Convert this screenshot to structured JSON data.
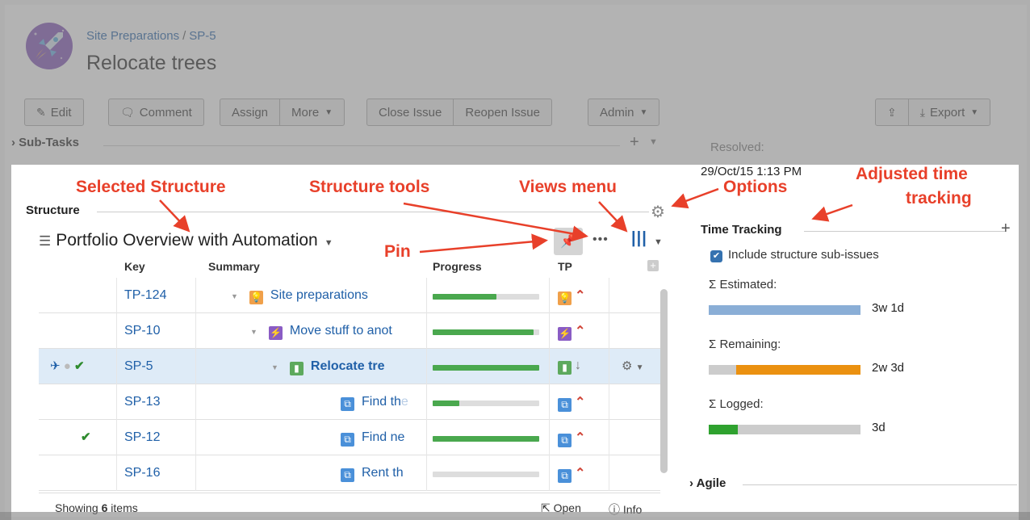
{
  "header": {
    "project": "Site Preparations",
    "separator": "/",
    "issue_key": "SP-5",
    "title": "Relocate trees"
  },
  "toolbar": {
    "edit": "Edit",
    "comment": "Comment",
    "assign": "Assign",
    "more": "More",
    "close_issue": "Close Issue",
    "reopen_issue": "Reopen Issue",
    "admin": "Admin",
    "export": "Export"
  },
  "subtasks": {
    "label": "Sub-Tasks"
  },
  "structure": {
    "label": "Structure",
    "name": "Portfolio Overview with Automation",
    "columns": {
      "key": "Key",
      "summary": "Summary",
      "progress": "Progress",
      "tp": "TP"
    },
    "rows": [
      {
        "key": "TP-124",
        "summary": "Site preparations",
        "summary_fade": "",
        "type": "bulb",
        "type_color": "#f0a04a",
        "progress": 0.6,
        "priority": "highest",
        "marks": ""
      },
      {
        "key": "SP-10",
        "summary": "Move stuff to anot",
        "summary_fade": "",
        "type": "bolt",
        "type_color": "#8a5cc4",
        "progress": 0.95,
        "priority": "highest",
        "marks": ""
      },
      {
        "key": "SP-5",
        "summary": "Relocate tre",
        "summary_fade": "",
        "type": "story",
        "type_color": "#5da95d",
        "progress": 1.0,
        "priority": "low",
        "marks": "pin-dot-check"
      },
      {
        "key": "SP-13",
        "summary": "Find th",
        "summary_fade": "e",
        "type": "subtask",
        "type_color": "#4a90d9",
        "progress": 0.25,
        "priority": "highest",
        "marks": ""
      },
      {
        "key": "SP-12",
        "summary": "Find ne",
        "summary_fade": "",
        "type": "subtask",
        "type_color": "#4a90d9",
        "progress": 1.0,
        "priority": "highest",
        "marks": "check"
      },
      {
        "key": "SP-16",
        "summary": "Rent th",
        "summary_fade": "",
        "type": "subtask",
        "type_color": "#4a90d9",
        "progress": 0.0,
        "priority": "highest",
        "marks": ""
      }
    ],
    "footer": {
      "showing_prefix": "Showing",
      "count": "6",
      "showing_suffix": "items",
      "open": "Open",
      "info": "Info"
    }
  },
  "right_panel": {
    "resolved_label": "Resolved:",
    "resolved_value": "29/Oct/15 1:13 PM",
    "time_tracking_title": "Time Tracking",
    "include_label": "Include structure sub-issues",
    "estimated_label": "Σ Estimated:",
    "estimated_value": "3w 1d",
    "remaining_label": "Σ Remaining:",
    "remaining_value": "2w 3d",
    "remaining_filled_fraction": 0.82,
    "logged_label": "Σ Logged:",
    "logged_value": "3d",
    "logged_filled_fraction": 0.19,
    "agile_label": "Agile"
  },
  "annotations": {
    "selected_structure": "Selected Structure",
    "structure_tools": "Structure tools",
    "views_menu": "Views menu",
    "options": "Options",
    "pin": "Pin",
    "adjusted_time_tracking_1": "Adjusted time",
    "adjusted_time_tracking_2": "tracking"
  },
  "colors": {
    "accent": "#2060a8",
    "annotation": "#e8402a",
    "progress_green": "#4aa84e",
    "estimated_blue": "#8aaed6",
    "remaining_orange": "#eb9110"
  }
}
